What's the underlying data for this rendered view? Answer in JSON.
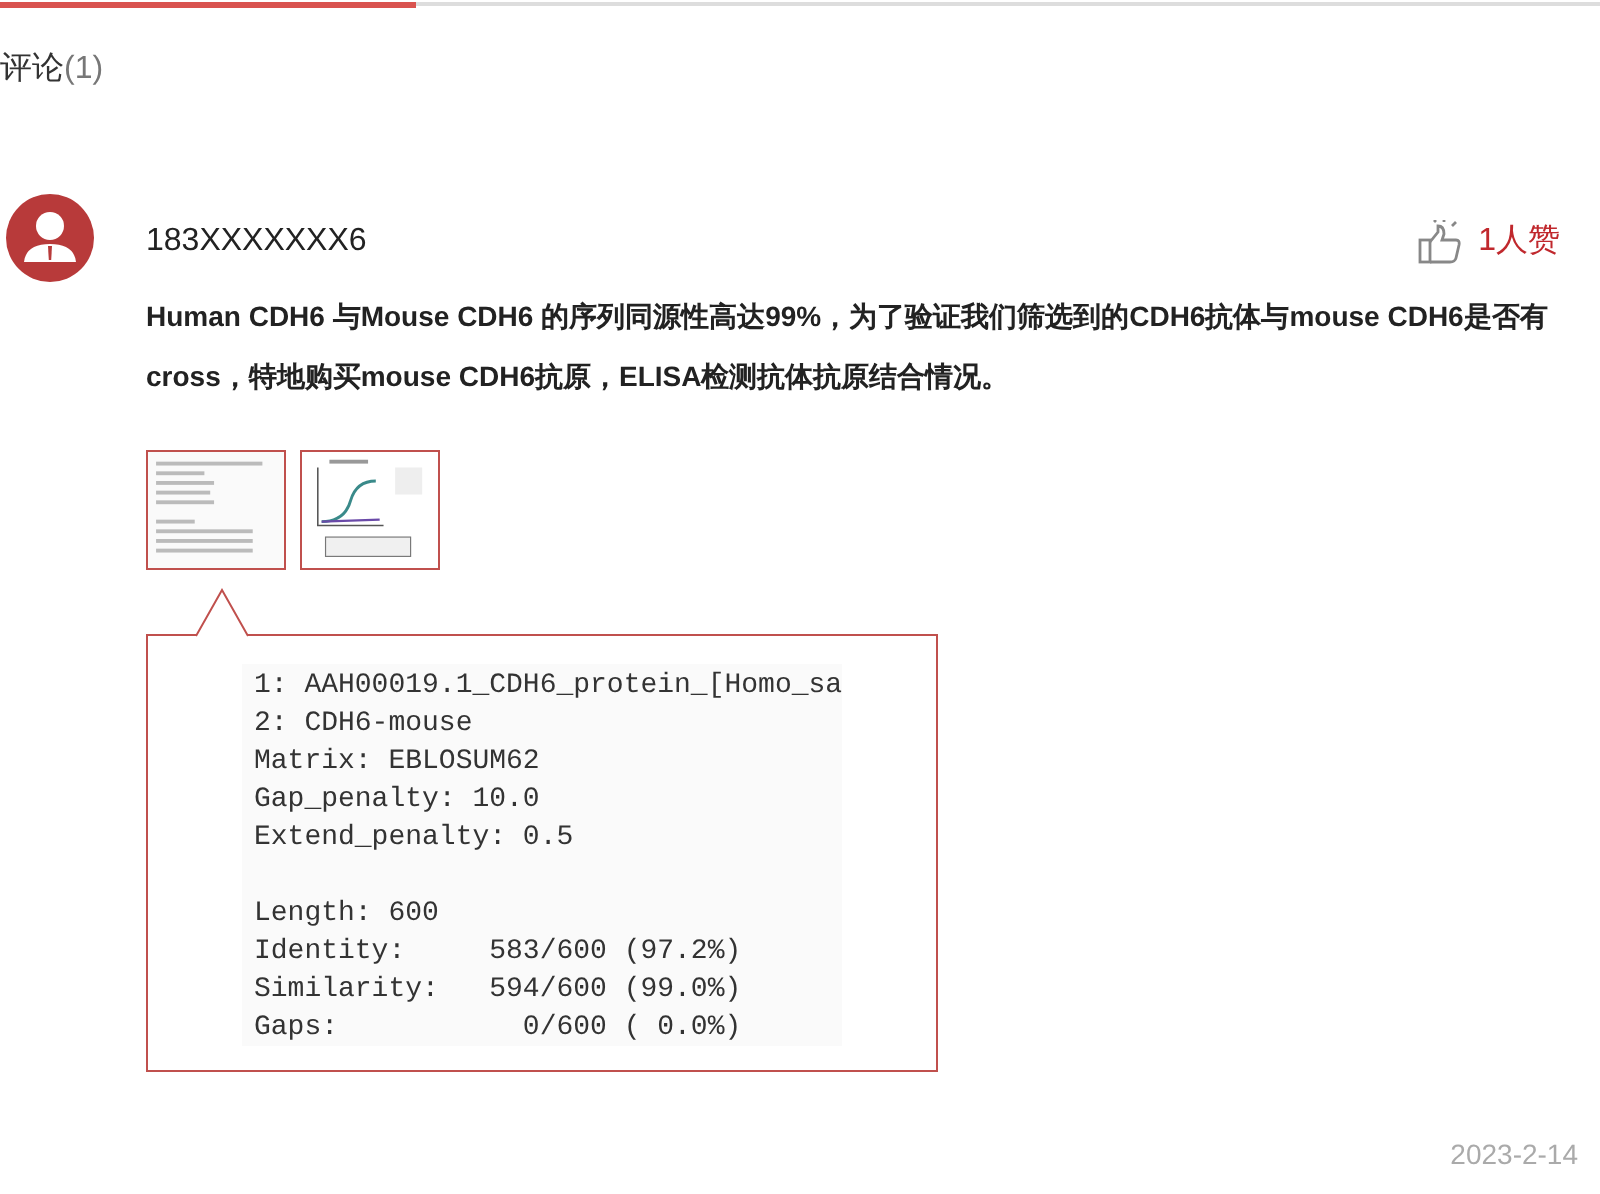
{
  "header": {
    "title": "评论",
    "count": "(1)"
  },
  "comments": [
    {
      "user": "183XXXXXXX6",
      "likes": "1人赞",
      "text": "Human CDH6 与Mouse CDH6 的序列同源性高达99%，为了验证我们筛选到的CDH6抗体与mouse CDH6是否有cross，特地购买mouse CDH6抗原，ELISA检测抗体抗原结合情况。",
      "attachments": [
        {
          "kind": "picture"
        },
        {
          "kind": "picture"
        }
      ],
      "preview_blocks": [
        [
          "1: AAH00019.1_CDH6_protein_[Homo_sa",
          "2: CDH6-mouse",
          "Matrix: EBLOSUM62",
          "Gap_penalty: 10.0",
          "Extend_penalty: 0.5"
        ],
        [
          "Length: 600",
          "Identity:     583/600 (97.2%)",
          "Similarity:   594/600 (99.0%)",
          "Gaps:           0/600 ( 0.0%)"
        ]
      ],
      "date": "2023-2-14"
    }
  ]
}
